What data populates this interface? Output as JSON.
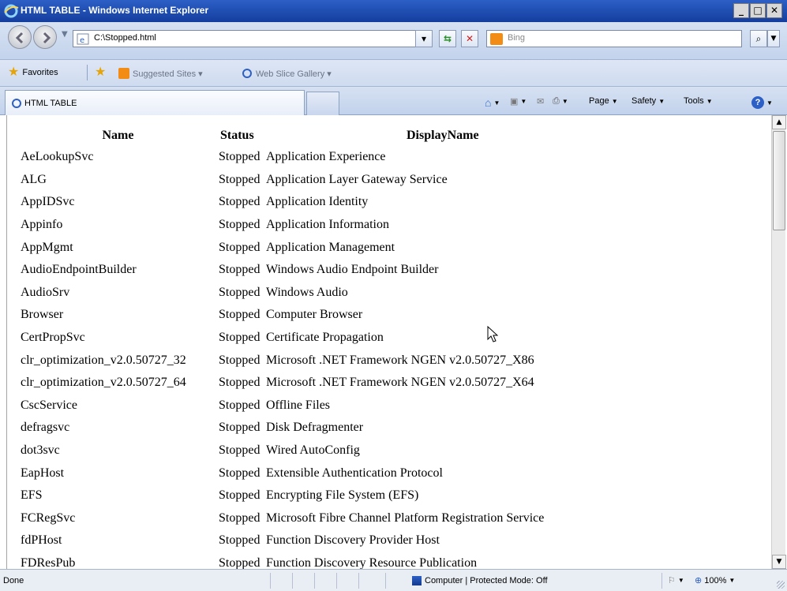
{
  "window": {
    "title": "HTML TABLE - Windows Internet Explorer",
    "minimize_label": "_",
    "maximize_label": "□",
    "close_label": "✕"
  },
  "addressbar": {
    "url": "C:\\Stopped.html",
    "search_placeholder": "Bing"
  },
  "favorites": {
    "favorites_label": "Favorites",
    "suggested_sites_label": "Suggested Sites ▾",
    "web_slice_gallery_label": "Web Slice Gallery ▾"
  },
  "tab": {
    "label": "HTML TABLE"
  },
  "commandbar": {
    "page_label": "Page",
    "safety_label": "Safety",
    "tools_label": "Tools",
    "help_label": "?"
  },
  "table": {
    "headers": [
      "Name",
      "Status",
      "DisplayName"
    ],
    "rows": [
      [
        "AeLookupSvc",
        "Stopped",
        "Application Experience"
      ],
      [
        "ALG",
        "Stopped",
        "Application Layer Gateway Service"
      ],
      [
        "AppIDSvc",
        "Stopped",
        "Application Identity"
      ],
      [
        "Appinfo",
        "Stopped",
        "Application Information"
      ],
      [
        "AppMgmt",
        "Stopped",
        "Application Management"
      ],
      [
        "AudioEndpointBuilder",
        "Stopped",
        "Windows Audio Endpoint Builder"
      ],
      [
        "AudioSrv",
        "Stopped",
        "Windows Audio"
      ],
      [
        "Browser",
        "Stopped",
        "Computer Browser"
      ],
      [
        "CertPropSvc",
        "Stopped",
        "Certificate Propagation"
      ],
      [
        "clr_optimization_v2.0.50727_32",
        "Stopped",
        "Microsoft .NET Framework NGEN v2.0.50727_X86"
      ],
      [
        "clr_optimization_v2.0.50727_64",
        "Stopped",
        "Microsoft .NET Framework NGEN v2.0.50727_X64"
      ],
      [
        "CscService",
        "Stopped",
        "Offline Files"
      ],
      [
        "defragsvc",
        "Stopped",
        "Disk Defragmenter"
      ],
      [
        "dot3svc",
        "Stopped",
        "Wired AutoConfig"
      ],
      [
        "EapHost",
        "Stopped",
        "Extensible Authentication Protocol"
      ],
      [
        "EFS",
        "Stopped",
        "Encrypting File System (EFS)"
      ],
      [
        "FCRegSvc",
        "Stopped",
        "Microsoft Fibre Channel Platform Registration Service"
      ],
      [
        "fdPHost",
        "Stopped",
        "Function Discovery Provider Host"
      ],
      [
        "FDResPub",
        "Stopped",
        "Function Discovery Resource Publication"
      ]
    ]
  },
  "statusbar": {
    "status": "Done",
    "zone": "Computer | Protected Mode: Off",
    "zoom": "100%"
  },
  "icons": {
    "back": "back-arrow-icon",
    "forward": "forward-arrow-icon",
    "home": "home-icon",
    "feeds": "feeds-icon",
    "mail": "mail-icon",
    "print": "printer-icon",
    "refresh": "compat-refresh-icon",
    "stop": "stop-icon",
    "search": "search-icon"
  },
  "colors": {
    "titlebar": "#1f4fb4",
    "chrome": "#cfdbef",
    "accent_orange": "#f38c14"
  }
}
